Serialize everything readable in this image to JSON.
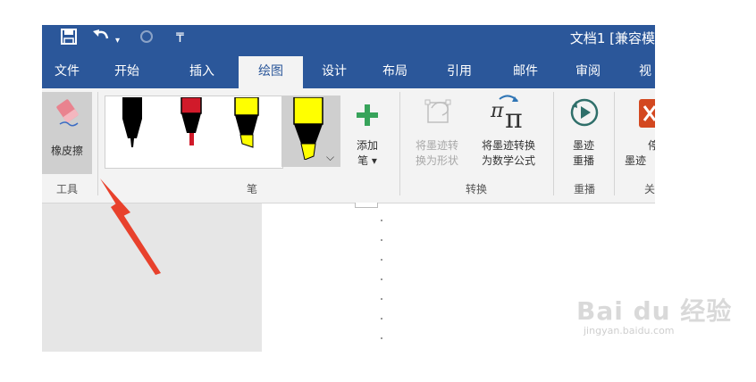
{
  "titlebar": {
    "title": "文档1 [兼容模",
    "qat_save_icon": "save-icon",
    "qat_undo_icon": "undo-icon",
    "qat_redo_icon": "redo-icon",
    "qat_customize_icon": "customize-qat-icon"
  },
  "tabs": [
    {
      "label": "文件"
    },
    {
      "label": "开始"
    },
    {
      "label": "插入"
    },
    {
      "label": "绘图",
      "active": true
    },
    {
      "label": "设计"
    },
    {
      "label": "布局"
    },
    {
      "label": "引用"
    },
    {
      "label": "邮件"
    },
    {
      "label": "审阅"
    },
    {
      "label": "视"
    }
  ],
  "ribbon": {
    "groups": {
      "tools": "工具",
      "pens": "笔",
      "convert": "转换",
      "replay": "重播",
      "close": "关"
    },
    "eraser_label": "橡皮擦",
    "add_pen_line1": "添加",
    "add_pen_line2": "笔 ▾",
    "ink_to_shape_line1": "将墨迹转",
    "ink_to_shape_line2": "换为形状",
    "ink_to_math_line1": "将墨迹转换",
    "ink_to_math_line2": "为数学公式",
    "ink_replay_line1": "墨迹",
    "ink_replay_line2": "重播",
    "stop_line1": "停",
    "stop_line2": "墨迹",
    "pens": [
      {
        "name": "black-pen",
        "color": "#000000"
      },
      {
        "name": "red-pen",
        "color": "#d11a2a"
      },
      {
        "name": "yellow-highlighter",
        "color": "#ffff00"
      },
      {
        "name": "yellow-highlighter-selected",
        "color": "#ffff00"
      }
    ]
  },
  "watermark": {
    "main": "Bai du 经验",
    "sub": "jingyan.baidu.com"
  },
  "colors": {
    "accent": "#2b579a",
    "ribbon_bg": "#f3f3f3",
    "arrow": "#e8412c"
  }
}
